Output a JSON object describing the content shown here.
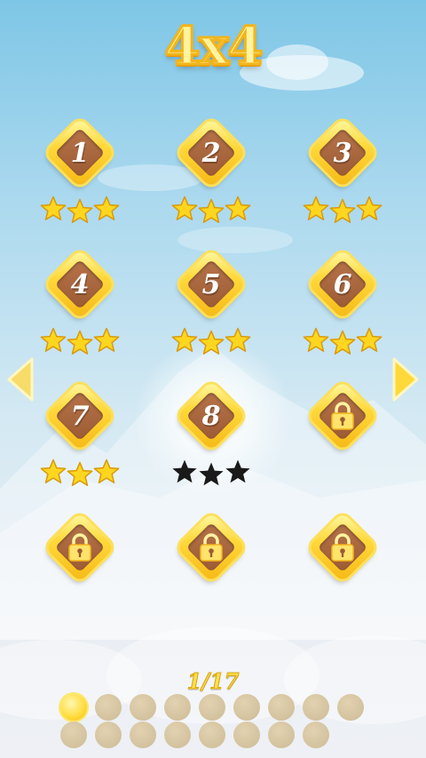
{
  "title": "4x4",
  "levels": [
    {
      "label": "1",
      "locked": false,
      "stars": 3
    },
    {
      "label": "2",
      "locked": false,
      "stars": 3
    },
    {
      "label": "3",
      "locked": false,
      "stars": 3
    },
    {
      "label": "4",
      "locked": false,
      "stars": 3
    },
    {
      "label": "5",
      "locked": false,
      "stars": 3
    },
    {
      "label": "6",
      "locked": false,
      "stars": 3
    },
    {
      "label": "7",
      "locked": false,
      "stars": 3
    },
    {
      "label": "8",
      "locked": false,
      "stars": 0
    },
    {
      "label": "",
      "locked": true,
      "stars": null
    },
    {
      "label": "",
      "locked": true,
      "stars": null
    },
    {
      "label": "",
      "locked": true,
      "stars": null
    },
    {
      "label": "",
      "locked": true,
      "stars": null
    }
  ],
  "navigation": {
    "prev_icon": "triangle-left-icon",
    "next_icon": "triangle-right-icon"
  },
  "pagination": {
    "label": "1/17",
    "current": 1,
    "total": 17
  },
  "colors": {
    "gold": "#ffd93a",
    "tile_brown": "#a9653c",
    "star_earned": "#ffd61f",
    "star_empty": "#1a1a1a",
    "dot_inactive": "#d4c29e",
    "dot_active": "#ffdb3a"
  }
}
